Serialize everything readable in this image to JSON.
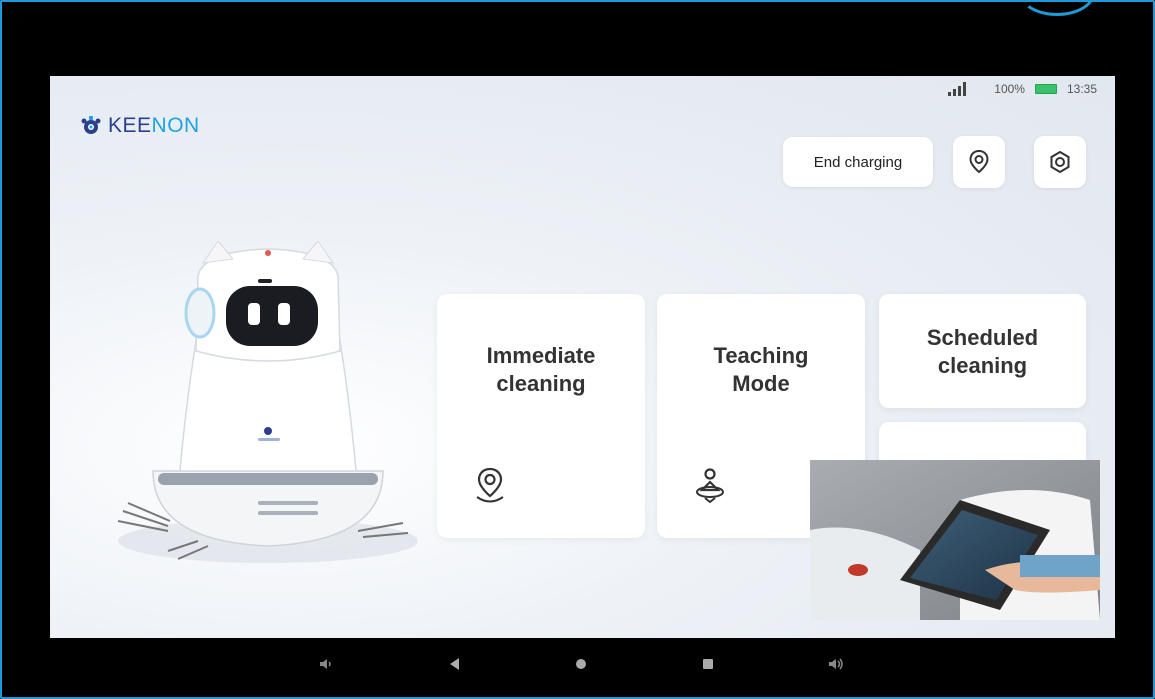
{
  "status_bar": {
    "battery": "100%",
    "time": "13:35"
  },
  "brand": {
    "name_primary": "KEE",
    "name_accent": "NON"
  },
  "header": {
    "end_charging_label": "End charging",
    "location_icon": "location-pin-icon",
    "settings_icon": "gear-icon"
  },
  "cards": [
    {
      "title": "Immediate\ncleaning",
      "icon": "location-pin-icon"
    },
    {
      "title": "Teaching\nMode",
      "icon": "teaching-person-icon"
    },
    {
      "title": "Scheduled\ncleaning"
    }
  ],
  "nav": [
    "volume-down-icon",
    "back-icon",
    "home-icon",
    "recents-icon",
    "volume-up-icon"
  ],
  "colors": {
    "brand_dark": "#2b3f8c",
    "brand_accent": "#1fa3e0",
    "battery": "#39c16c",
    "frame": "#1e9ad6"
  }
}
